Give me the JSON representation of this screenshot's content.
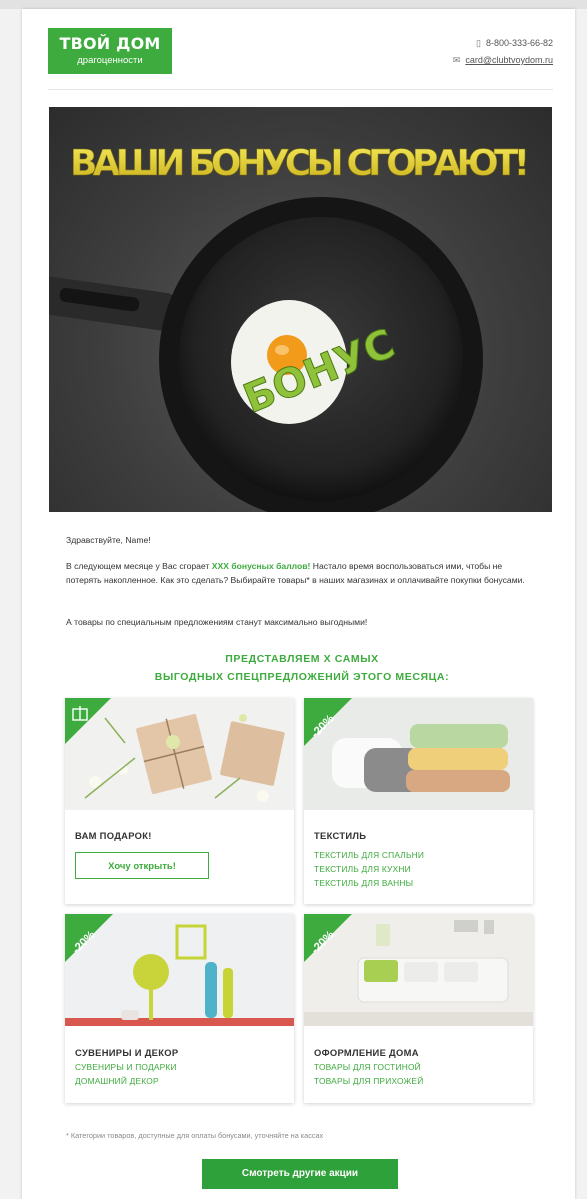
{
  "header": {
    "logo_line1": "ТВОЙ ДОМ",
    "logo_line2": "драгоценности",
    "phone": "8-800-333-66-82",
    "email": "card@clubtvoydom.ru"
  },
  "hero": {
    "headline": "ВАШИ БОНУСЫ СГОРАЮТ!",
    "pan_word": "БОНУС"
  },
  "letter": {
    "greeting": "Здравствуйте, Name!",
    "p1_before": "В следующем месяце у Вас сгорает ",
    "p1_highlight": "ХХХ бонусных баллов!",
    "p1_after": " Настало время воспользоваться ими, чтобы не потерять накопленное. Как это сделать? Выбирайте товары* в наших магазинах и оплачивайте покупки бонусами.",
    "p2": "А товары по специальным предложениям станут максимально выгодными!"
  },
  "offers": {
    "title_line1": "ПРЕДСТАВЛЯЕМ Х САМЫХ",
    "title_line2": "ВЫГОДНЫХ СПЕЦПРЕДЛОЖЕНИЙ ЭТОГО МЕСЯЦА:",
    "discount_badge": "-20%",
    "cards": [
      {
        "title": "ВАМ ПОДАРОК!",
        "button": "Хочу открыть!"
      },
      {
        "title": "ТЕКСТИЛЬ",
        "links": [
          "ТЕКСТИЛЬ ДЛЯ СПАЛЬНИ",
          "ТЕКСТИЛЬ ДЛЯ КУХНИ",
          "ТЕКСТИЛЬ ДЛЯ ВАННЫ"
        ]
      },
      {
        "title": "СУВЕНИРЫ И ДЕКОР",
        "links": [
          "СУВЕНИРЫ И ПОДАРКИ",
          "ДОМАШНИЙ ДЕКОР"
        ]
      },
      {
        "title": "ОФОРМЛЕНИЕ ДОМА",
        "links": [
          "ТОВАРЫ ДЛЯ ГОСТИНОЙ",
          "ТОВАРЫ ДЛЯ ПРИХОЖЕЙ"
        ]
      }
    ]
  },
  "footer": {
    "note": "* Категории товаров, доступные для оплаты бонусами, уточняйте на кассах",
    "cta": "Смотреть другие акции"
  },
  "colors": {
    "brand_green": "#3dab3d",
    "headline_yellow": "#e8d42a"
  }
}
